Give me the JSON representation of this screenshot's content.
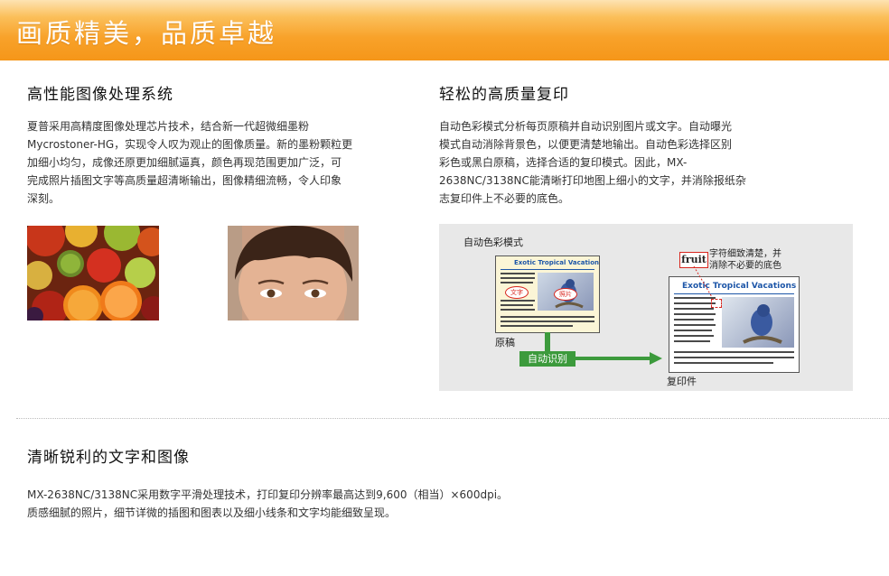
{
  "banner": {
    "title": "画质精美，品质卓越"
  },
  "section1": {
    "heading": "高性能图像处理系统",
    "lines": [
      "夏普采用高精度图像处理芯片技术，结合新一代超微细墨粉",
      "Mycrostoner-HG，实现令人叹为观止的图像质量。新的墨粉颗粒更",
      "加细小均匀，成像还原更加细腻逼真，颜色再现范围更加广泛，可",
      "完成照片插图文字等高质量超清晰输出，图像精细流畅，令人印象",
      "深刻。"
    ]
  },
  "section2": {
    "heading": "轻松的高质量复印",
    "lines": [
      "自动色彩模式分析每页原稿并自动识别图片或文字。自动曝光",
      "模式自动消除背景色，以便更清楚地输出。自动色彩选择区别",
      "彩色或黑白原稿，选择合适的复印模式。因此，MX-",
      "2638NC/3138NC能清晰打印地图上细小的文字，并消除报纸杂",
      "志复印件上不必要的底色。"
    ],
    "diagram": {
      "mode_label": "自动色彩模式",
      "doc_title": "Exotic Tropical Vacations",
      "text_tag": "文字",
      "photo_tag": "照片",
      "original_label": "原稿",
      "recognize_label": "自动识别",
      "fruit_word": "fruit",
      "callout_line1": "字符细致清楚，并",
      "callout_line2": "消除不必要的底色",
      "copy_label": "复印件"
    }
  },
  "section3": {
    "heading": "清晰锐利的文字和图像",
    "lines": [
      "MX-2638NC/3138NC采用数字平滑处理技术，打印复印分辨率最高达到9,600（相当）×600dpi。",
      "质感细腻的照片，细节详微的插图和图表以及细小线条和文字均能细致呈现。"
    ]
  }
}
